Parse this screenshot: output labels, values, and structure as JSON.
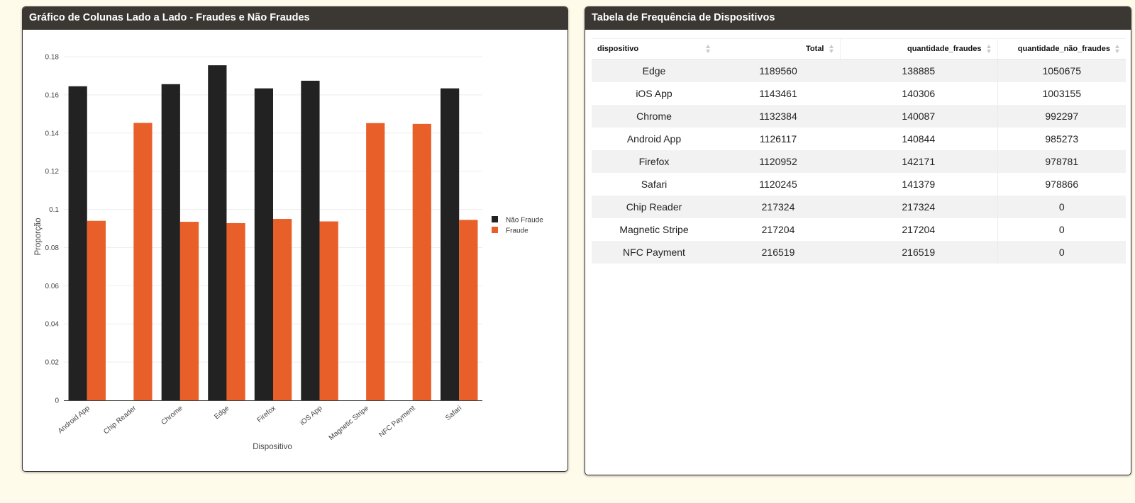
{
  "chart_panel": {
    "title": "Gráfico de Colunas Lado a Lado - Fraudes e Não Fraudes"
  },
  "table_panel": {
    "title": "Tabela de Frequência de Dispositivos",
    "columns": [
      "dispositivo",
      "Total",
      "quantidade_fraudes",
      "quantidade_não_fraudes"
    ],
    "rows": [
      [
        "Edge",
        "1189560",
        "138885",
        "1050675"
      ],
      [
        "iOS App",
        "1143461",
        "140306",
        "1003155"
      ],
      [
        "Chrome",
        "1132384",
        "140087",
        "992297"
      ],
      [
        "Android App",
        "1126117",
        "140844",
        "985273"
      ],
      [
        "Firefox",
        "1120952",
        "142171",
        "978781"
      ],
      [
        "Safari",
        "1120245",
        "141379",
        "978866"
      ],
      [
        "Chip Reader",
        "217324",
        "217324",
        "0"
      ],
      [
        "Magnetic Stripe",
        "217204",
        "217204",
        "0"
      ],
      [
        "NFC Payment",
        "216519",
        "216519",
        "0"
      ]
    ]
  },
  "colors": {
    "nao_fraude": "#222222",
    "fraude": "#e95f29",
    "header_bg": "#3b3834",
    "page_bg": "#fffbeb"
  },
  "chart_data": {
    "type": "bar",
    "title": "",
    "xlabel": "Dispositivo",
    "ylabel": "Proporção",
    "categories": [
      "Android App",
      "Chip Reader",
      "Chrome",
      "Edge",
      "Firefox",
      "iOS App",
      "Magnetic Stripe",
      "NFC Payment",
      "Safari"
    ],
    "series": [
      {
        "name": "Não Fraude",
        "color": "#222222",
        "values": [
          0.1645,
          null,
          0.1656,
          0.1755,
          0.1634,
          0.1674,
          null,
          null,
          0.1634
        ]
      },
      {
        "name": "Fraude",
        "color": "#e95f29",
        "values": [
          0.094,
          0.1453,
          0.0935,
          0.0928,
          0.095,
          0.0937,
          0.1452,
          0.1448,
          0.0945
        ]
      }
    ],
    "ylim": [
      0,
      0.18
    ],
    "yticks": [
      0,
      0.02,
      0.04,
      0.06,
      0.08,
      0.1,
      0.12,
      0.14,
      0.16,
      0.18
    ],
    "ytick_labels": [
      "0",
      "0.02",
      "0.04",
      "0.06",
      "0.08",
      "0.1",
      "0.12",
      "0.14",
      "0.16",
      "0.18"
    ],
    "grid": true,
    "legend": "right"
  }
}
